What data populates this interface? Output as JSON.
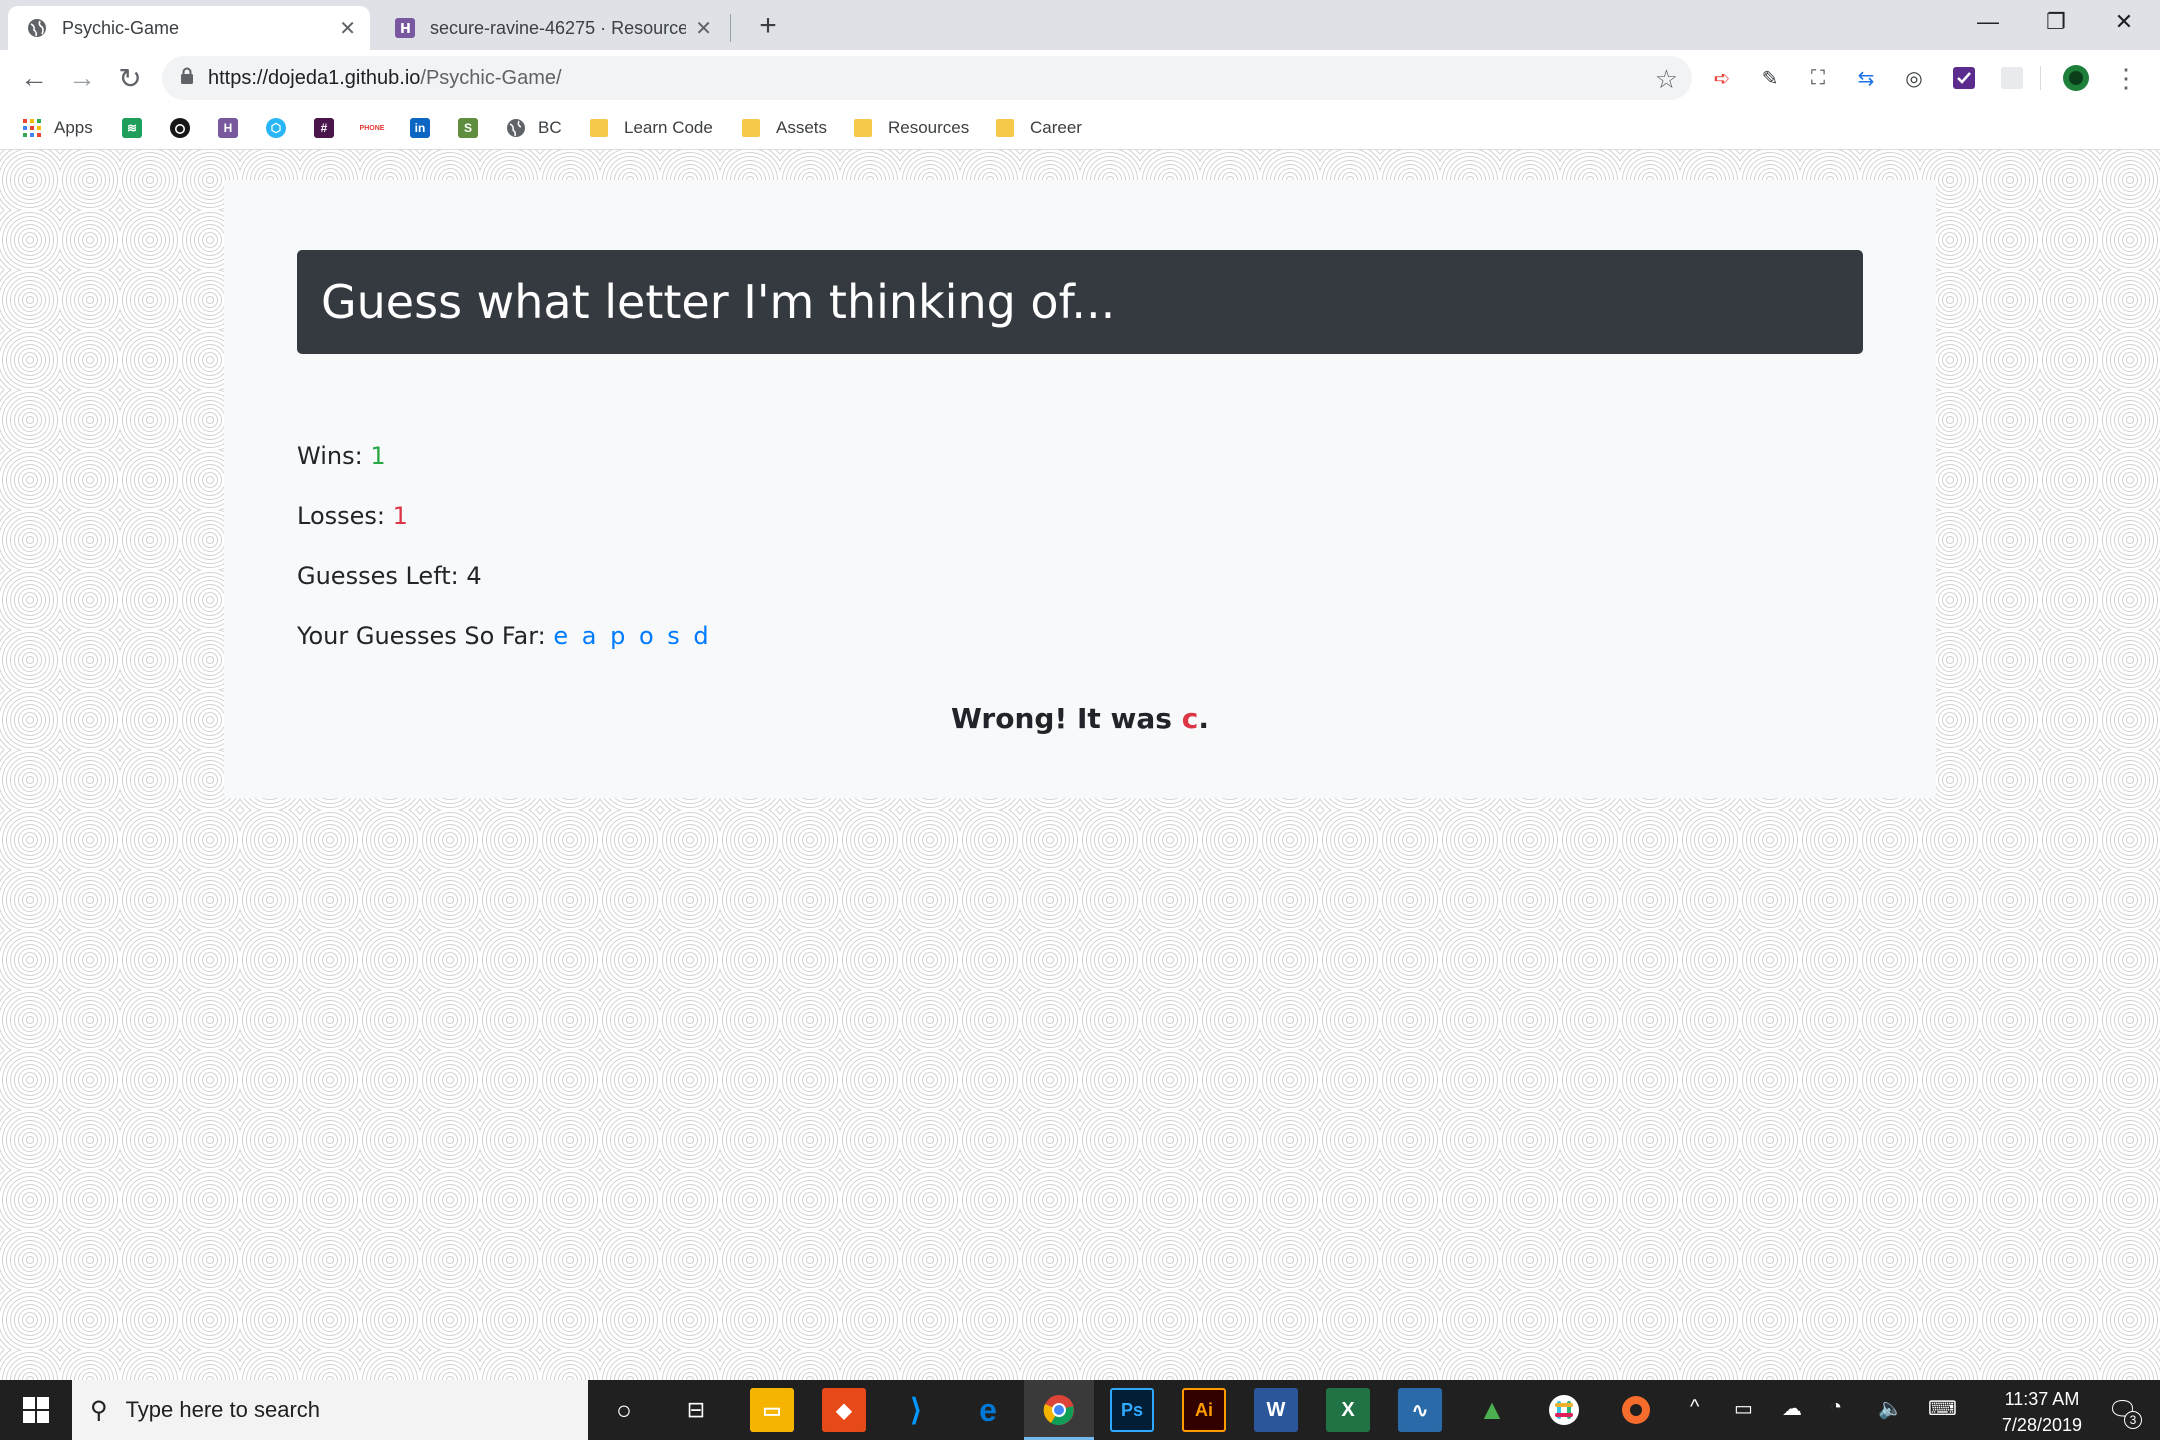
{
  "browser": {
    "tabs": [
      {
        "label": "Psychic-Game",
        "active": true
      },
      {
        "label": "secure-ravine-46275 · Resources",
        "active": false
      }
    ],
    "url": {
      "host": "https://dojeda1.github.io",
      "path": "/Psychic-Game/"
    },
    "bookmarks": [
      {
        "label": "Apps"
      },
      {
        "label": "BC"
      },
      {
        "label": "Learn Code"
      },
      {
        "label": "Assets"
      },
      {
        "label": "Resources"
      },
      {
        "label": "Career"
      }
    ]
  },
  "game": {
    "title": "Guess what letter I'm thinking of...",
    "wins_label": "Wins:",
    "wins_value": "1",
    "losses_label": "Losses:",
    "losses_value": "1",
    "guesses_left_label": "Guesses Left:",
    "guesses_left_value": "4",
    "guesses_so_far_label": "Your Guesses So Far:",
    "guesses_so_far_value": "e a p o s d",
    "result_prefix": "Wrong! It was",
    "result_letter": "c",
    "result_suffix": "."
  },
  "taskbar": {
    "search_placeholder": "Type here to search",
    "time": "11:37 AM",
    "date": "7/28/2019",
    "notification_count": "3"
  },
  "colors": {
    "jumbotron": "#343a40",
    "wins": "#28a745",
    "losses": "#dc3545",
    "guesses": "#007bff"
  }
}
